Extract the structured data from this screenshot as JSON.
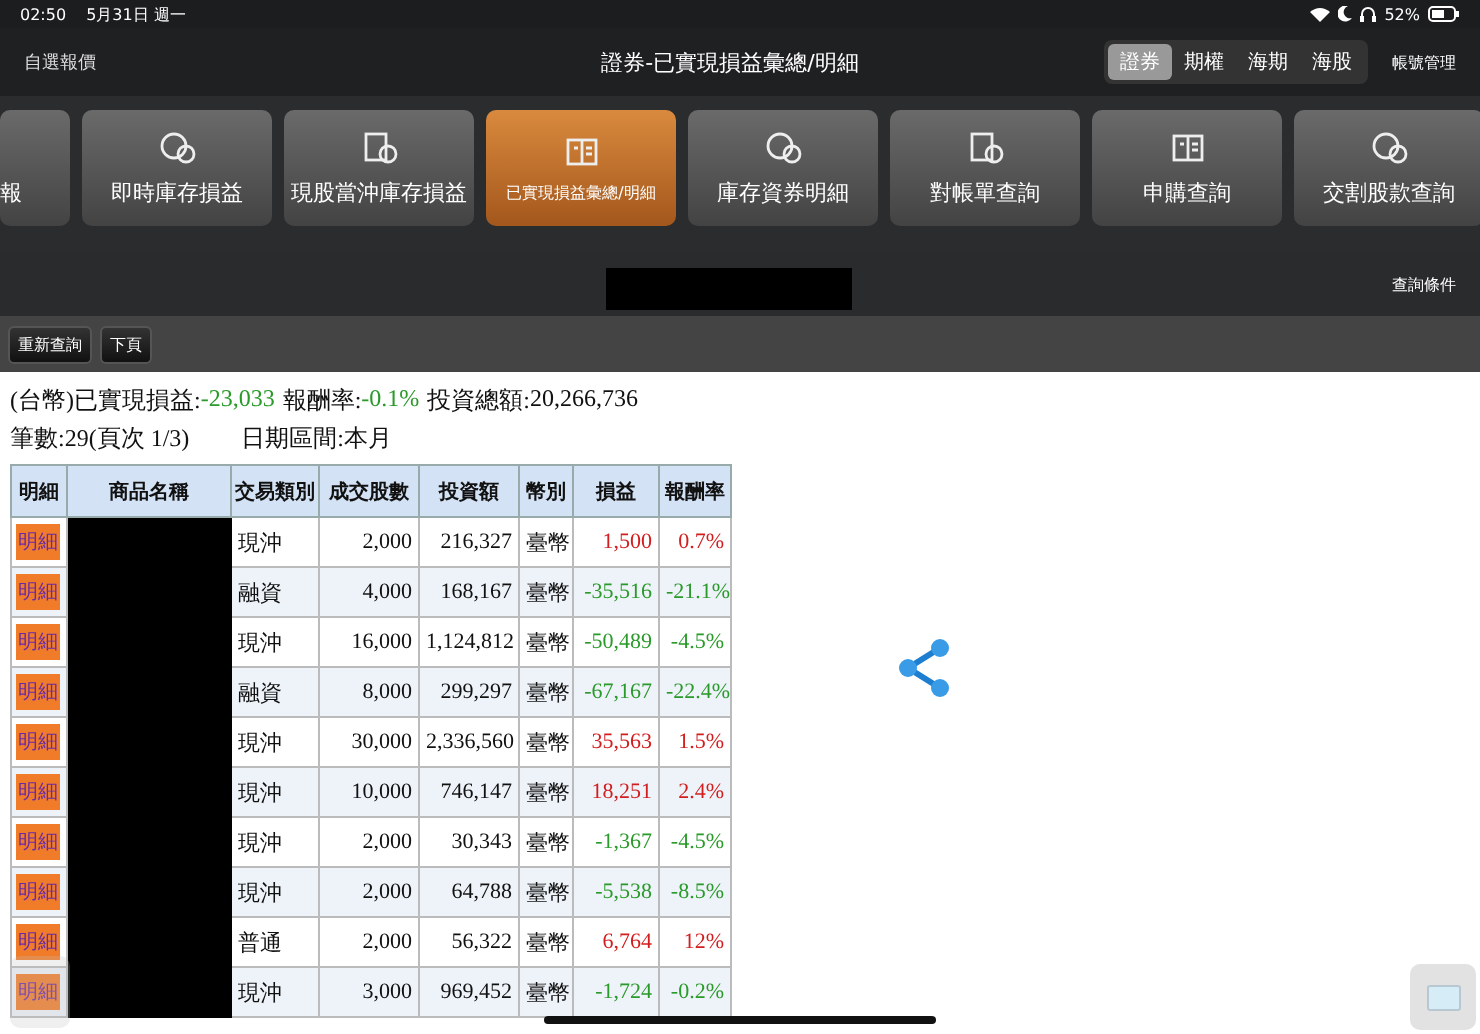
{
  "status_bar": {
    "time": "02:50",
    "date": "5月31日 週一",
    "battery": "52%"
  },
  "nav": {
    "left": "自選報價",
    "title": "證券-已實現損益彙總/明細",
    "segments": [
      {
        "label": "證券",
        "selected": true
      },
      {
        "label": "期權",
        "selected": false
      },
      {
        "label": "海期",
        "selected": false
      },
      {
        "label": "海股",
        "selected": false
      }
    ],
    "right": "帳號管理"
  },
  "menu": [
    {
      "label": "報",
      "selected": false
    },
    {
      "label": "即時庫存損益",
      "selected": false
    },
    {
      "label": "現股當沖庫存損益",
      "selected": false
    },
    {
      "label": "已實現損益彙總/明細",
      "selected": true
    },
    {
      "label": "庫存資券明細",
      "selected": false
    },
    {
      "label": "對帳單查詢",
      "selected": false
    },
    {
      "label": "申購查詢",
      "selected": false
    },
    {
      "label": "交割股款查詢",
      "selected": false
    }
  ],
  "query_conditions": "查詢條件",
  "buttons": [
    "重新查詢",
    "下頁"
  ],
  "summary": [
    {
      "label": "(台幣)已實現損益:",
      "value": "-23,033",
      "gain": false
    },
    {
      "label": "報酬率:",
      "value": "-0.1%",
      "gain": false
    },
    {
      "label": "投資總額:",
      "value": "20,266,736"
    }
  ],
  "info": [
    "筆數:29(頁次 1/3)",
    "日期區間:本月"
  ],
  "table": {
    "columns": [
      "明細",
      "商品名稱",
      "交易類別",
      "成交股數",
      "投資額",
      "幣別",
      "損益",
      "報酬率"
    ],
    "rows": [
      {
        "detail": "明細",
        "type": "現沖",
        "shares": "2,000",
        "amount": "216,327",
        "currency": "臺幣",
        "pnl": "1,500",
        "rate": "0.7%",
        "gain": true
      },
      {
        "detail": "明細",
        "type": "融資",
        "shares": "4,000",
        "amount": "168,167",
        "currency": "臺幣",
        "pnl": "-35,516",
        "rate": "-21.1%",
        "gain": false
      },
      {
        "detail": "明細",
        "type": "現沖",
        "shares": "16,000",
        "amount": "1,124,812",
        "currency": "臺幣",
        "pnl": "-50,489",
        "rate": "-4.5%",
        "gain": false
      },
      {
        "detail": "明細",
        "type": "融資",
        "shares": "8,000",
        "amount": "299,297",
        "currency": "臺幣",
        "pnl": "-67,167",
        "rate": "-22.4%",
        "gain": false
      },
      {
        "detail": "明細",
        "type": "現沖",
        "shares": "30,000",
        "amount": "2,336,560",
        "currency": "臺幣",
        "pnl": "35,563",
        "rate": "1.5%",
        "gain": true
      },
      {
        "detail": "明細",
        "type": "現沖",
        "shares": "10,000",
        "amount": "746,147",
        "currency": "臺幣",
        "pnl": "18,251",
        "rate": "2.4%",
        "gain": true
      },
      {
        "detail": "明細",
        "type": "現沖",
        "shares": "2,000",
        "amount": "30,343",
        "currency": "臺幣",
        "pnl": "-1,367",
        "rate": "-4.5%",
        "gain": false
      },
      {
        "detail": "明細",
        "type": "現沖",
        "shares": "2,000",
        "amount": "64,788",
        "currency": "臺幣",
        "pnl": "-5,538",
        "rate": "-8.5%",
        "gain": false
      },
      {
        "detail": "明細",
        "type": "普通",
        "shares": "2,000",
        "amount": "56,322",
        "currency": "臺幣",
        "pnl": "6,764",
        "rate": "12%",
        "gain": true
      },
      {
        "detail": "明細",
        "type": "現沖",
        "shares": "3,000",
        "amount": "969,452",
        "currency": "臺幣",
        "pnl": "-1,724",
        "rate": "-0.2%",
        "gain": false
      }
    ]
  }
}
